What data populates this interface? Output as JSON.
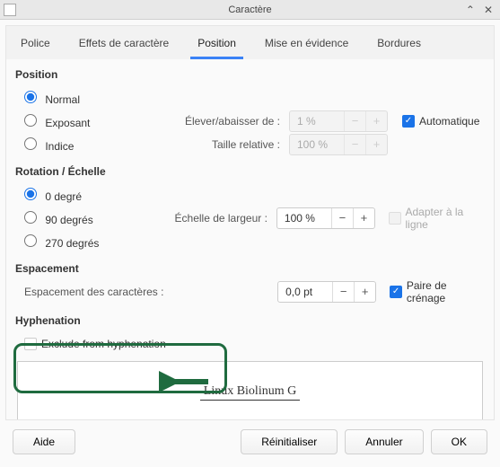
{
  "window": {
    "title": "Caractère"
  },
  "tabs": {
    "police": "Police",
    "effets": "Effets de caractère",
    "position": "Position",
    "mise": "Mise en évidence",
    "bordures": "Bordures"
  },
  "position": {
    "title": "Position",
    "normal": "Normal",
    "exposant": "Exposant",
    "indice": "Indice",
    "raise_label": "Élever/abaisser de :",
    "raise_value": "1 %",
    "relative_label": "Taille relative :",
    "relative_value": "100 %",
    "auto": "Automatique"
  },
  "rotation": {
    "title": "Rotation / Échelle",
    "deg0": "0 degré",
    "deg90": "90 degrés",
    "deg270": "270 degrés",
    "scale_label": "Échelle de largeur :",
    "scale_value": "100 %",
    "fit": "Adapter à la ligne"
  },
  "spacing": {
    "title": "Espacement",
    "label": "Espacement des caractères :",
    "value": "0,0 pt",
    "kerning": "Paire de crénage"
  },
  "hyphenation": {
    "title": "Hyphenation",
    "exclude": "Exclude from hyphenation"
  },
  "preview": {
    "text": "Linux Biolinum G"
  },
  "buttons": {
    "help": "Aide",
    "reset": "Réinitialiser",
    "cancel": "Annuler",
    "ok": "OK"
  }
}
